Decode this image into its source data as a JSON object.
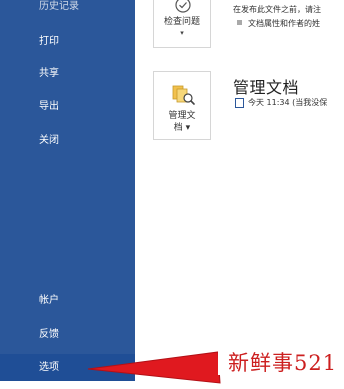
{
  "sidebar": {
    "items": [
      {
        "label": "历史记录"
      },
      {
        "label": "打印"
      },
      {
        "label": "共享"
      },
      {
        "label": "导出"
      },
      {
        "label": "关闭"
      },
      {
        "label": "帐户"
      },
      {
        "label": "反馈"
      },
      {
        "label": "选项"
      }
    ]
  },
  "main": {
    "inspect": {
      "tile_label": "检查问题",
      "caret": "▾",
      "description": "在发布此文件之前，请注",
      "bullet_text": "文档属性和作者的姓"
    },
    "manage": {
      "title": "管理文档",
      "tile_label": "管理文\n档 ▾",
      "version_text": "今天 11:34 (当我没保"
    }
  },
  "watermark": {
    "text": "新鲜事521"
  },
  "colors": {
    "sidebar": "#2b579a",
    "sidebar_selected": "#1f4e96",
    "arrow": "#e0191f"
  }
}
